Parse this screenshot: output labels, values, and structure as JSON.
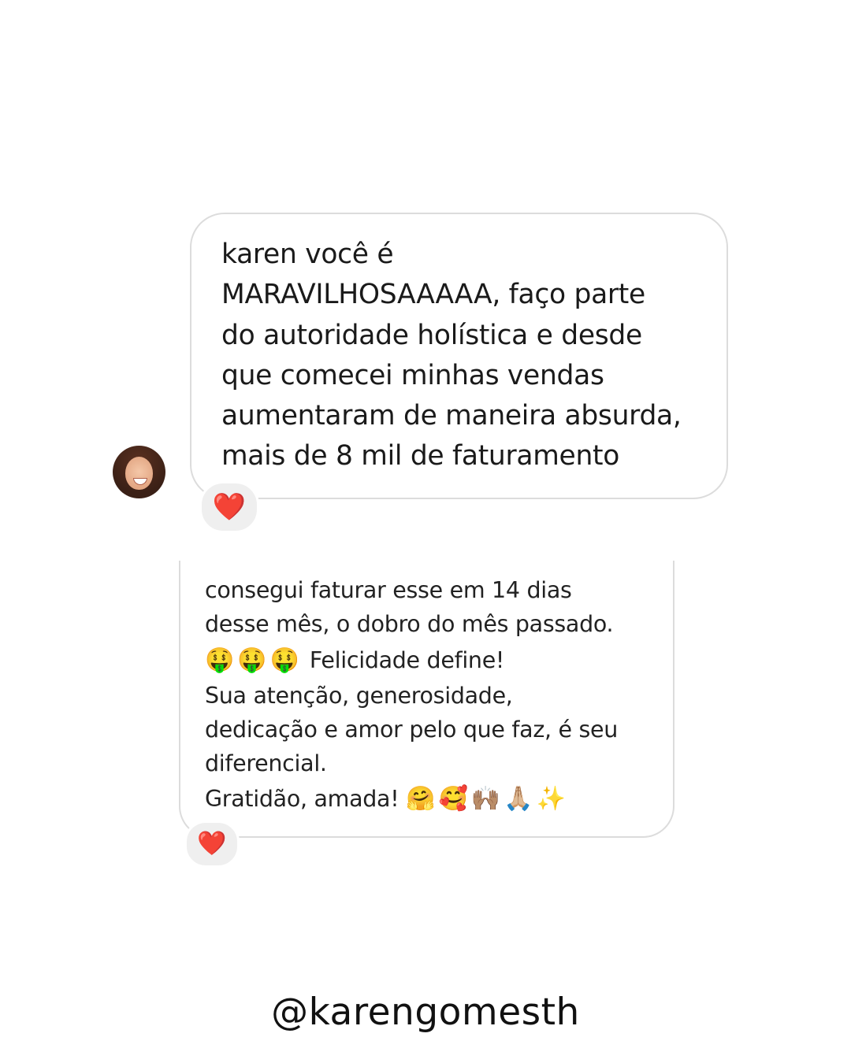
{
  "message_1": {
    "lines": [
      "karen você é",
      "MARAVILHOSAAAAA, faço parte",
      "do autoridade holística e desde",
      "que comecei minhas vendas",
      "aumentaram de maneira absurda,",
      "mais de 8 mil de faturamento"
    ],
    "reaction": "❤️"
  },
  "message_2": {
    "lines": [
      "consegui faturar  esse em 14 dias",
      "desse mês, o dobro do mês passado.",
      "Sua atenção, generosidade,",
      "dedicação e amor pelo que faz, é seu",
      "diferencial."
    ],
    "emoji_line": {
      "emojis": "🤑🤑🤑",
      "text": " Felicidade define!"
    },
    "last_line": {
      "text": "Gratidão, amada! ",
      "emojis": "🤗🥰🙌🏽🙏🏼✨"
    },
    "reaction": "❤️"
  },
  "footer": {
    "handle": "@karengomesth"
  },
  "colors": {
    "bubble_border": "#dcdcdc",
    "reaction_bg": "#efefef",
    "heart": "#e3262e"
  }
}
